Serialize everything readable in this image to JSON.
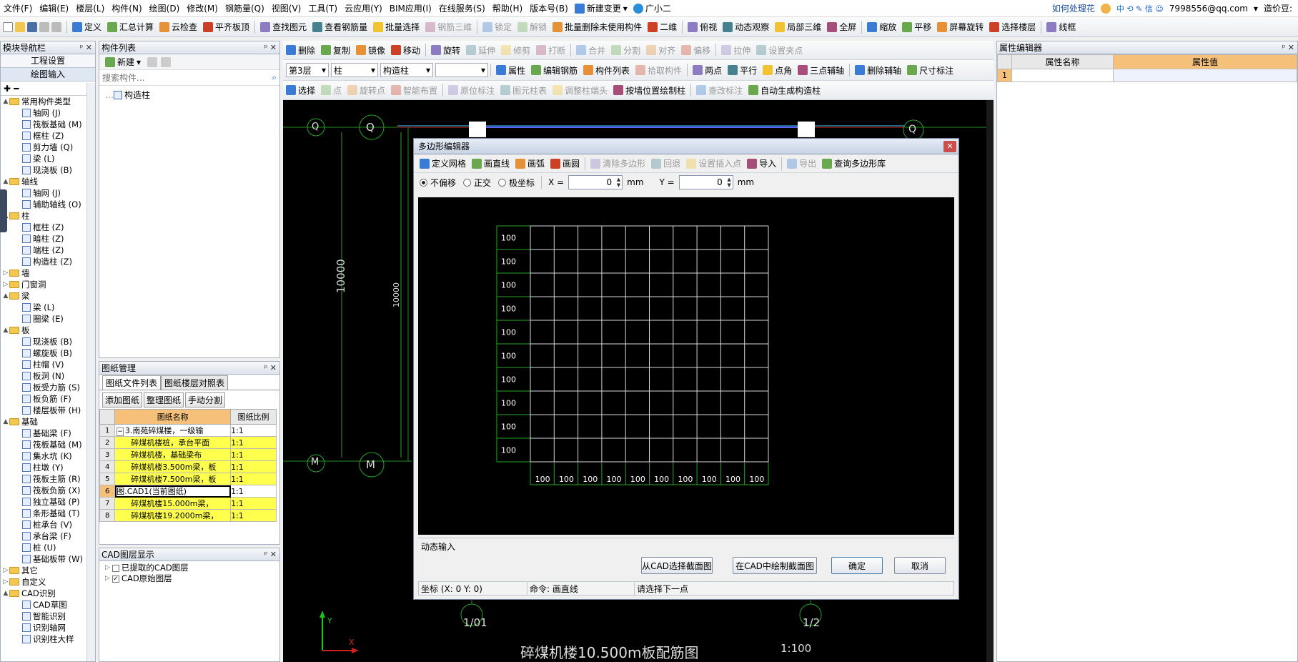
{
  "menu": {
    "items": [
      "文件(F)",
      "编辑(E)",
      "楼层(L)",
      "构件(N)",
      "绘图(D)",
      "修改(M)",
      "钢筋量(Q)",
      "视图(V)",
      "工具(T)",
      "云应用(Y)",
      "BIM应用(I)",
      "在线服务(S)",
      "帮助(H)",
      "版本号(B)"
    ],
    "new_change": "新建变更",
    "assistant": "广小二",
    "right_link": "如何处理花",
    "account": "7998556@qq.com",
    "account_right": "造价豆:"
  },
  "toolbar1": [
    "定义",
    "汇总计算",
    "云检查",
    "平齐板顶",
    "查找图元",
    "查看钢筋量",
    "批量选择",
    "钢筋三维",
    "锁定",
    "解锁",
    "批量删除未使用构件",
    "二维",
    "俯视",
    "动态观察",
    "局部三维",
    "全屏",
    "缩放",
    "平移",
    "屏幕旋转",
    "选择楼层",
    "线框"
  ],
  "toolbar2": [
    "删除",
    "复制",
    "镜像",
    "移动",
    "旋转",
    "延伸",
    "修剪",
    "打断",
    "合并",
    "分割",
    "对齐",
    "偏移",
    "拉伸",
    "设置夹点"
  ],
  "toolbar3": {
    "floor": "第3层",
    "type": "柱",
    "subtype": "构造柱",
    "sub2": "",
    "buttons": [
      "属性",
      "编辑钢筋",
      "构件列表",
      "拾取构件",
      "两点",
      "平行",
      "点角",
      "三点辅轴",
      "删除辅轴",
      "尺寸标注"
    ]
  },
  "toolbar4": [
    "选择",
    "点",
    "旋转点",
    "智能布置",
    "原位标注",
    "图元柱表",
    "调整柱端头",
    "按墙位置绘制柱",
    "查改标注",
    "自动生成构造柱"
  ],
  "nav": {
    "title": "模块导航栏",
    "tabs": [
      "工程设置",
      "绘图输入"
    ],
    "tree": [
      {
        "level": 0,
        "toggle": "▲",
        "label": "常用构件类型",
        "folder": true
      },
      {
        "level": 1,
        "label": "轴网 (J)"
      },
      {
        "level": 1,
        "label": "筏板基础 (M)"
      },
      {
        "level": 1,
        "label": "框柱 (Z)"
      },
      {
        "level": 1,
        "label": "剪力墙 (Q)"
      },
      {
        "level": 1,
        "label": "梁 (L)"
      },
      {
        "level": 1,
        "label": "现浇板 (B)"
      },
      {
        "level": 0,
        "toggle": "▲",
        "label": "轴线",
        "folder": true
      },
      {
        "level": 1,
        "label": "轴网 (J)"
      },
      {
        "level": 1,
        "label": "辅助轴线 (O)"
      },
      {
        "level": 0,
        "toggle": "▲",
        "label": "柱",
        "folder": true
      },
      {
        "level": 1,
        "label": "框柱 (Z)"
      },
      {
        "level": 1,
        "label": "暗柱 (Z)"
      },
      {
        "level": 1,
        "label": "端柱 (Z)"
      },
      {
        "level": 1,
        "label": "构造柱 (Z)"
      },
      {
        "level": 0,
        "toggle": "▷",
        "label": "墙",
        "folder": true
      },
      {
        "level": 0,
        "toggle": "▷",
        "label": "门窗洞",
        "folder": true
      },
      {
        "level": 0,
        "toggle": "▲",
        "label": "梁",
        "folder": true
      },
      {
        "level": 1,
        "label": "梁 (L)"
      },
      {
        "level": 1,
        "label": "圈梁 (E)"
      },
      {
        "level": 0,
        "toggle": "▲",
        "label": "板",
        "folder": true
      },
      {
        "level": 1,
        "label": "现浇板 (B)"
      },
      {
        "level": 1,
        "label": "螺旋板 (B)"
      },
      {
        "level": 1,
        "label": "柱帽 (V)"
      },
      {
        "level": 1,
        "label": "板洞 (N)"
      },
      {
        "level": 1,
        "label": "板受力筋 (S)"
      },
      {
        "level": 1,
        "label": "板负筋 (F)"
      },
      {
        "level": 1,
        "label": "楼层板带 (H)"
      },
      {
        "level": 0,
        "toggle": "▲",
        "label": "基础",
        "folder": true
      },
      {
        "level": 1,
        "label": "基础梁 (F)"
      },
      {
        "level": 1,
        "label": "筏板基础 (M)"
      },
      {
        "level": 1,
        "label": "集水坑 (K)"
      },
      {
        "level": 1,
        "label": "柱墩 (Y)"
      },
      {
        "level": 1,
        "label": "筏板主筋 (R)"
      },
      {
        "level": 1,
        "label": "筏板负筋 (X)"
      },
      {
        "level": 1,
        "label": "独立基础 (P)"
      },
      {
        "level": 1,
        "label": "条形基础 (T)"
      },
      {
        "level": 1,
        "label": "桩承台 (V)"
      },
      {
        "level": 1,
        "label": "承台梁 (F)"
      },
      {
        "level": 1,
        "label": "桩 (U)"
      },
      {
        "level": 1,
        "label": "基础板带 (W)"
      },
      {
        "level": 0,
        "toggle": "▷",
        "label": "其它",
        "folder": true
      },
      {
        "level": 0,
        "toggle": "▷",
        "label": "自定义",
        "folder": true
      },
      {
        "level": 0,
        "toggle": "▲",
        "label": "CAD识别",
        "folder": true
      },
      {
        "level": 1,
        "label": "CAD草图"
      },
      {
        "level": 1,
        "label": "智能识别"
      },
      {
        "level": 1,
        "label": "识别轴网"
      },
      {
        "level": 1,
        "label": "识别柱大样"
      },
      {
        "level": 1,
        "label": "识别柱"
      }
    ]
  },
  "component_list": {
    "title": "构件列表",
    "new_button": "新建",
    "search_placeholder": "搜索构件...",
    "items": [
      "构造柱"
    ]
  },
  "drawings": {
    "title": "图纸管理",
    "tabs": [
      "图纸文件列表",
      "图纸楼层对照表"
    ],
    "buttons": [
      "添加图纸",
      "整理图纸",
      "手动分割"
    ],
    "headers": [
      "图纸名称",
      "图纸比例"
    ],
    "rows": [
      {
        "n": "1",
        "name": "3.南苑碎煤楼，一级输",
        "scale": "1:1"
      },
      {
        "n": "2",
        "name": "碎煤机楼桩，承台平面",
        "scale": "1:1"
      },
      {
        "n": "3",
        "name": "碎煤机楼，基础梁布",
        "scale": "1:1"
      },
      {
        "n": "4",
        "name": "碎煤机楼3.500m梁，板",
        "scale": "1:1"
      },
      {
        "n": "5",
        "name": "碎煤机楼7.500m梁，板",
        "scale": "1:1"
      },
      {
        "n": "6",
        "name": "图.CAD1(当前图纸)",
        "scale": "1:1"
      },
      {
        "n": "7",
        "name": "碎煤机楼15.000m梁，",
        "scale": "1:1"
      },
      {
        "n": "8",
        "name": "碎煤机楼19.2000m梁，",
        "scale": "1:1"
      }
    ]
  },
  "cad_layers": {
    "title": "CAD图层显示",
    "items": [
      "已提取的CAD图层",
      "CAD原始图层"
    ]
  },
  "props": {
    "title": "属性编辑器",
    "headers": [
      "属性名称",
      "属性值"
    ],
    "row_index": "1"
  },
  "drawing": {
    "axis_Q": "Q",
    "axis_M": "M",
    "dim_big": "10000",
    "dim_small": "10000",
    "axis_101": "1/01",
    "axis_12": "1/2",
    "title_text": "碎煤机楼10.500m板配筋图",
    "scale_text": "1:100",
    "ucs_y": "Y",
    "ucs_x": "X"
  },
  "dialog": {
    "title": "多边形编辑器",
    "toolbar": [
      "定义网格",
      "画直线",
      "画弧",
      "画圆",
      "清除多边形",
      "回退",
      "设置插入点",
      "导入",
      "导出",
      "查询多边形库"
    ],
    "mode_options": [
      "不偏移",
      "正交",
      "极坐标"
    ],
    "x_label": "X =",
    "x_value": "0",
    "y_label": "Y =",
    "y_value": "0",
    "unit": "mm",
    "grid_labels": "100",
    "grid_rows": 10,
    "grid_cols": 10,
    "dynamic_input": "动态输入",
    "buttons": [
      "从CAD选择截面图",
      "在CAD中绘制截面图",
      "确定",
      "取消"
    ],
    "status_coord": "坐标 (X: 0 Y: 0)",
    "status_cmd": "命令: 画直线",
    "status_prompt": "请选择下一点"
  }
}
